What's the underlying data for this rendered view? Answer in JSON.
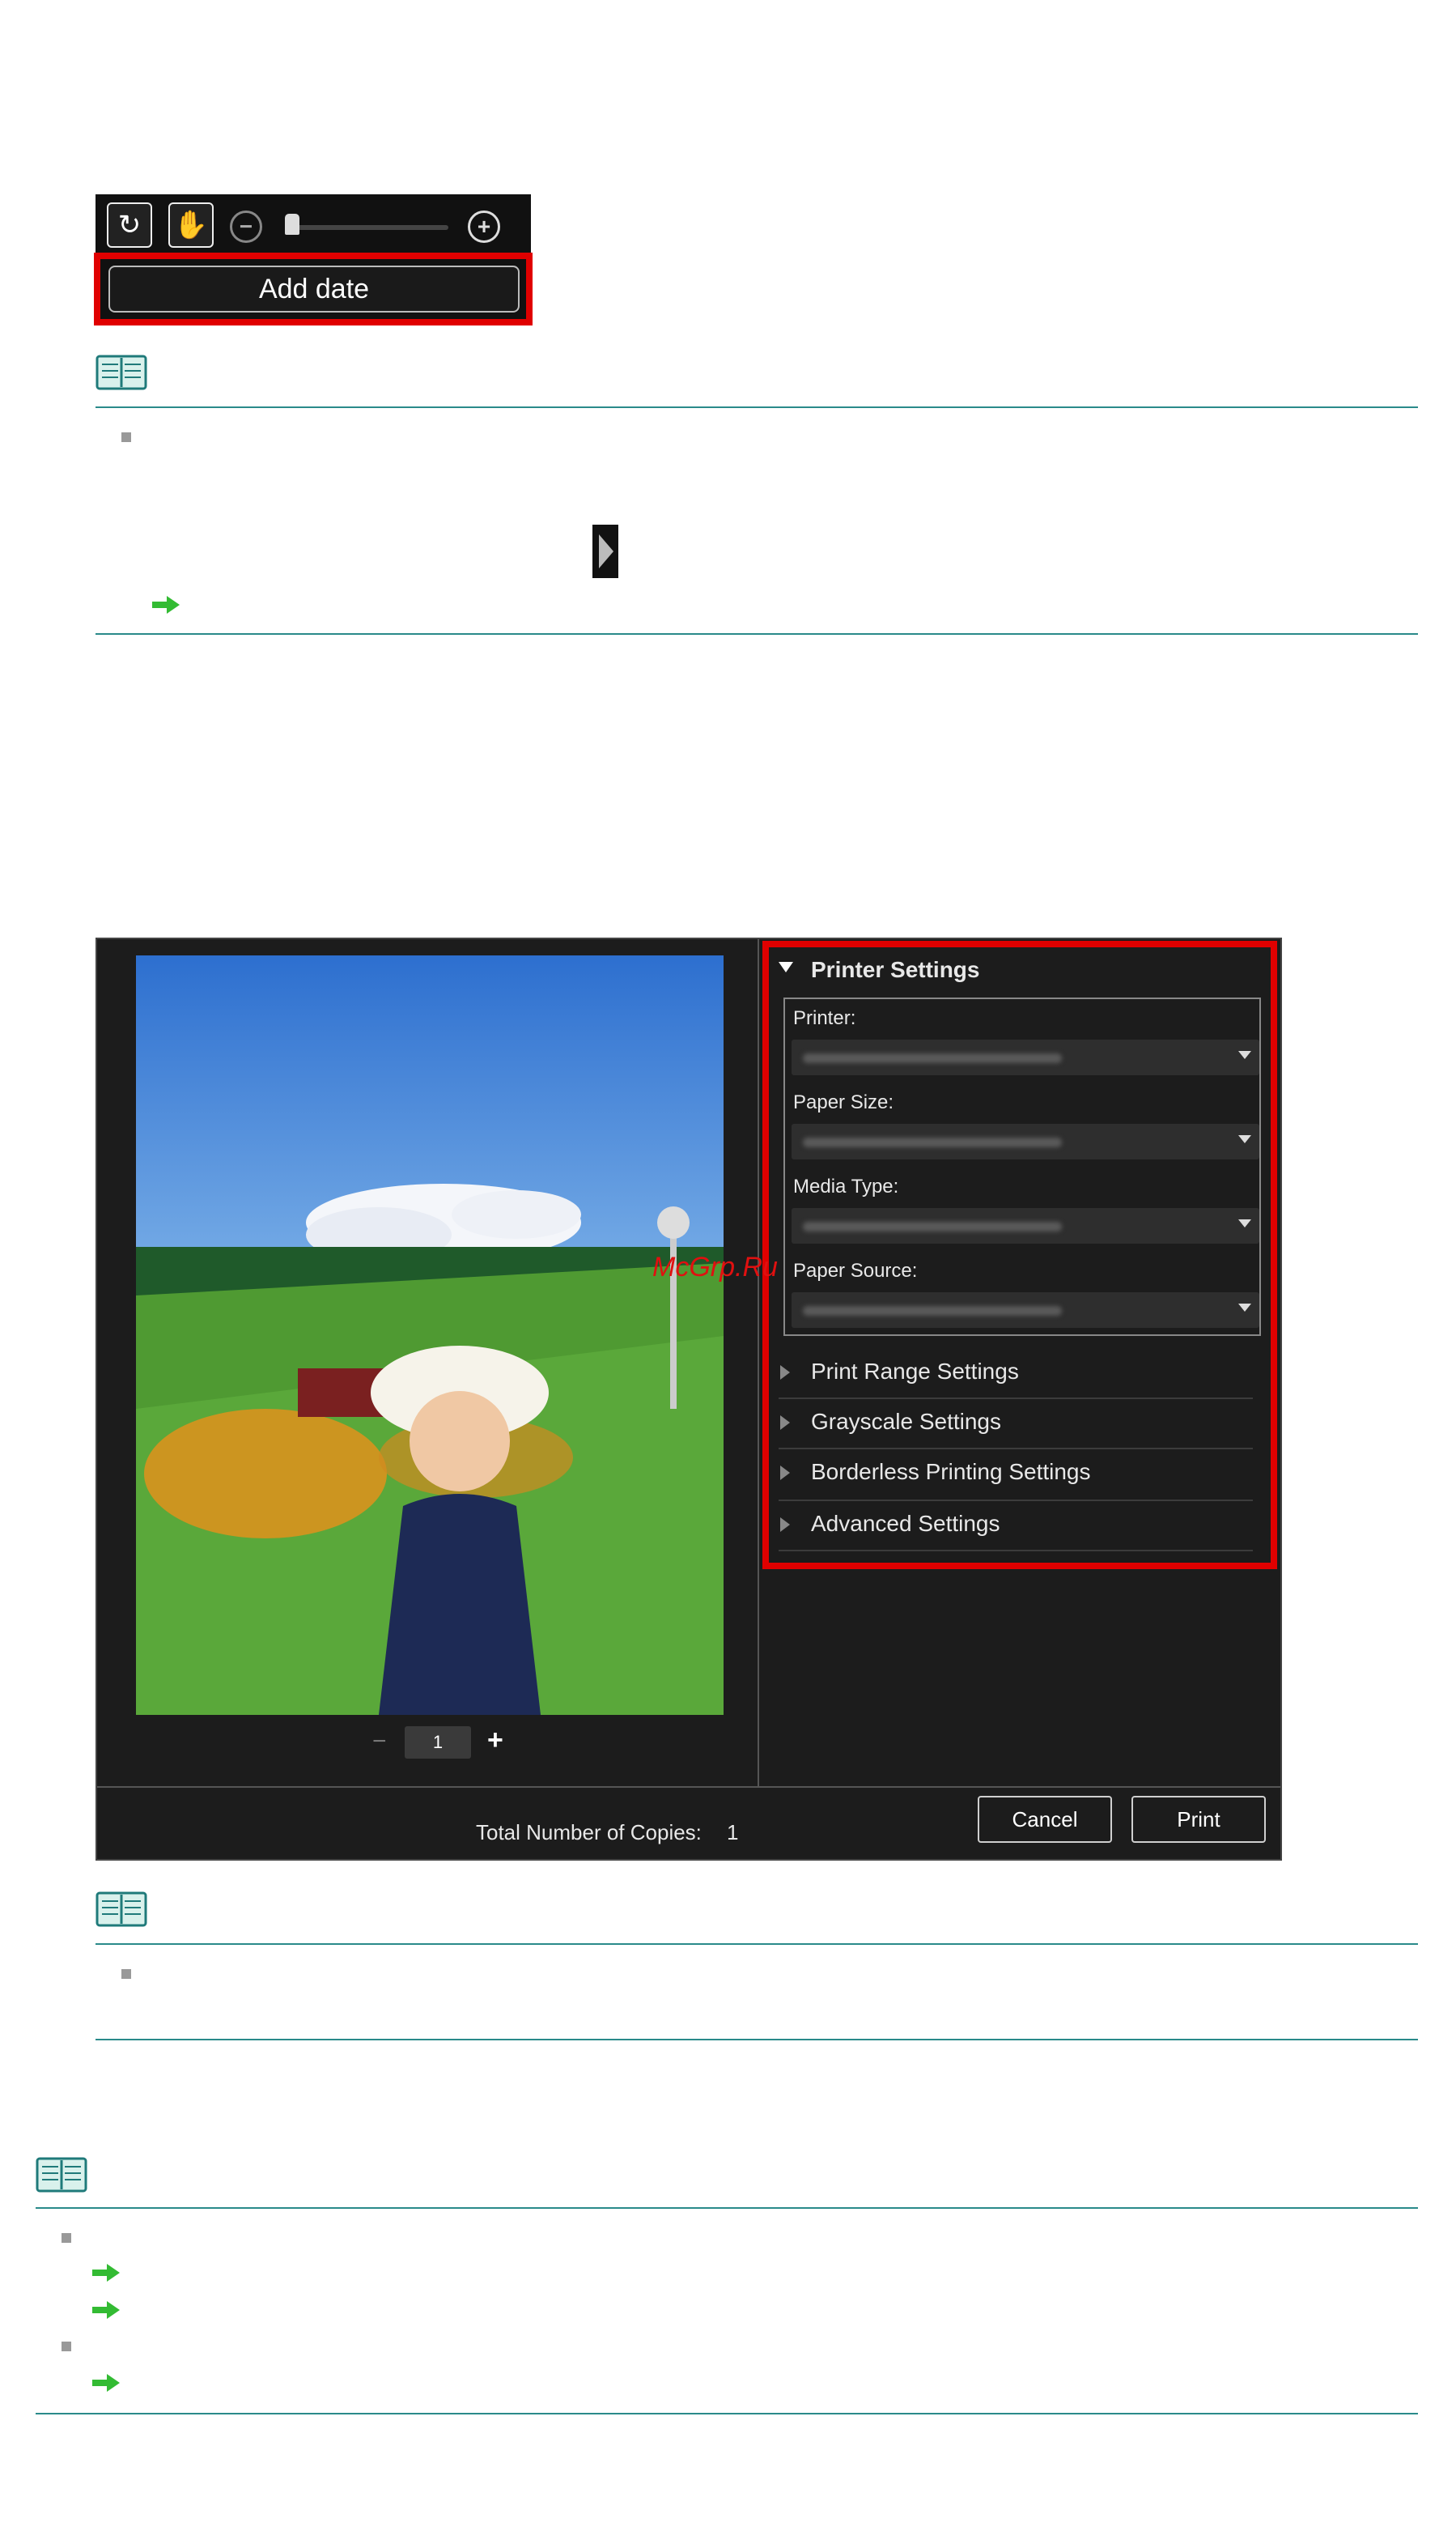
{
  "toolbar": {
    "rotate_icon": "rotate-icon",
    "pan_icon": "hand-icon",
    "zoom_out_symbol": "−",
    "zoom_in_symbol": "+",
    "zoom_level": 0.02,
    "add_date_label": "Add date"
  },
  "print_dialog": {
    "printer_settings_title": "Printer Settings",
    "fields": [
      {
        "label": "Printer:"
      },
      {
        "label": "Paper Size:"
      },
      {
        "label": "Media Type:"
      },
      {
        "label": "Paper Source:"
      }
    ],
    "sections": [
      "Print Range Settings",
      "Grayscale Settings",
      "Borderless Printing Settings",
      "Advanced Settings"
    ],
    "copies_value": "1",
    "minus_label": "−",
    "plus_label": "+",
    "total_copies_label": "Total Number of Copies:",
    "total_copies_value": "1",
    "cancel_label": "Cancel",
    "print_label": "Print"
  },
  "watermark": "McGrp.Ru",
  "colors": {
    "highlight": "#e00000",
    "rule": "#2a8a8a",
    "arrow": "#33bb33"
  }
}
